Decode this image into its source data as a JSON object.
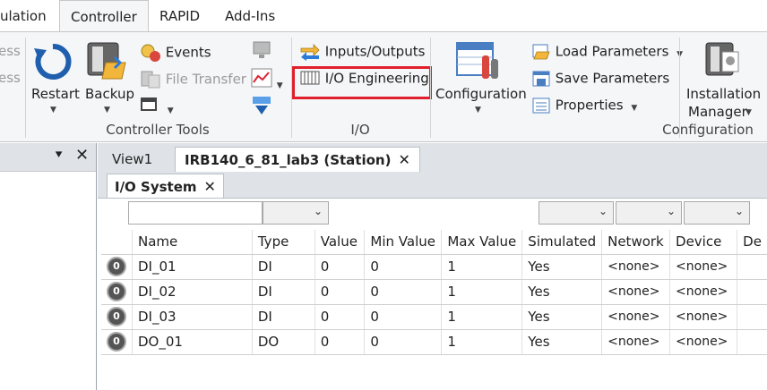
{
  "ribbon_tabs": [
    {
      "label": "ulation",
      "active": false
    },
    {
      "label": "Controller",
      "active": true
    },
    {
      "label": "RAPID",
      "active": false
    },
    {
      "label": "Add-Ins",
      "active": false
    }
  ],
  "ribbon": {
    "cut_items": [
      "ess",
      "ess"
    ],
    "controller_tools": {
      "restart": "Restart",
      "backup": "Backup",
      "events": "Events",
      "file_transfer": "File Transfer",
      "group_label": "Controller Tools"
    },
    "io": {
      "inputs_outputs": "Inputs/Outputs",
      "io_engineering": "I/O Engineering",
      "group_label": "I/O"
    },
    "configuration": {
      "configuration": "Configuration",
      "load_parameters": "Load Parameters",
      "save_parameters": "Save Parameters",
      "properties": "Properties",
      "installation_manager_line1": "Installation",
      "installation_manager_line2": "Manager",
      "group_label": "Configuration"
    },
    "highlight_color": "#e0202c"
  },
  "document_tabs": [
    {
      "label": "View1",
      "selected": false
    },
    {
      "label": "IRB140_6_81_lab3 (Station)",
      "selected": true
    }
  ],
  "sub_tab": "I/O System",
  "grid": {
    "columns": [
      "Name",
      "Type",
      "Value",
      "Min Value",
      "Max Value",
      "Simulated",
      "Network",
      "Device",
      "De"
    ],
    "rows": [
      {
        "name": "DI_01",
        "type": "DI",
        "value": "0",
        "min": "0",
        "max": "1",
        "simulated": "Yes",
        "network": "<none>",
        "device": "<none>"
      },
      {
        "name": "DI_02",
        "type": "DI",
        "value": "0",
        "min": "0",
        "max": "1",
        "simulated": "Yes",
        "network": "<none>",
        "device": "<none>"
      },
      {
        "name": "DI_03",
        "type": "DI",
        "value": "0",
        "min": "0",
        "max": "1",
        "simulated": "Yes",
        "network": "<none>",
        "device": "<none>"
      },
      {
        "name": "DO_01",
        "type": "DO",
        "value": "0",
        "min": "0",
        "max": "1",
        "simulated": "Yes",
        "network": "<none>",
        "device": "<none>"
      }
    ],
    "status_glyph": "0"
  }
}
